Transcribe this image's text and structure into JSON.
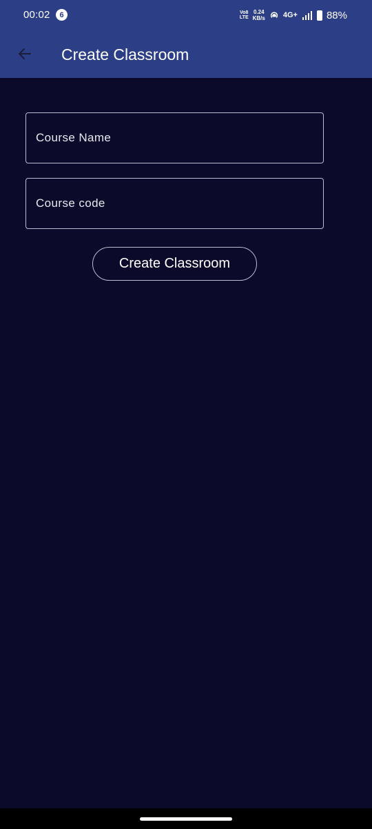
{
  "status_bar": {
    "time": "00:02",
    "notification_count": "6",
    "volte_top": "Vo8",
    "volte_bottom": "LTE",
    "speed_value": "0.24",
    "speed_unit": "KB/s",
    "network_type": "4G+",
    "battery": "88%",
    "icons": [
      "hotspot-icon",
      "signal-icon",
      "battery-icon"
    ]
  },
  "app_bar": {
    "title": "Create Classroom",
    "back_icon": "arrow-left-icon"
  },
  "form": {
    "course_name": {
      "placeholder": "Course Name",
      "value": ""
    },
    "course_code": {
      "placeholder": "Course code",
      "value": ""
    },
    "submit_label": "Create Classroom"
  },
  "colors": {
    "header": "#2c3f86",
    "background": "#0b0a2a",
    "border": "#b9bdd0",
    "text": "#ffffff",
    "back_icon": "#1b1d3a"
  }
}
